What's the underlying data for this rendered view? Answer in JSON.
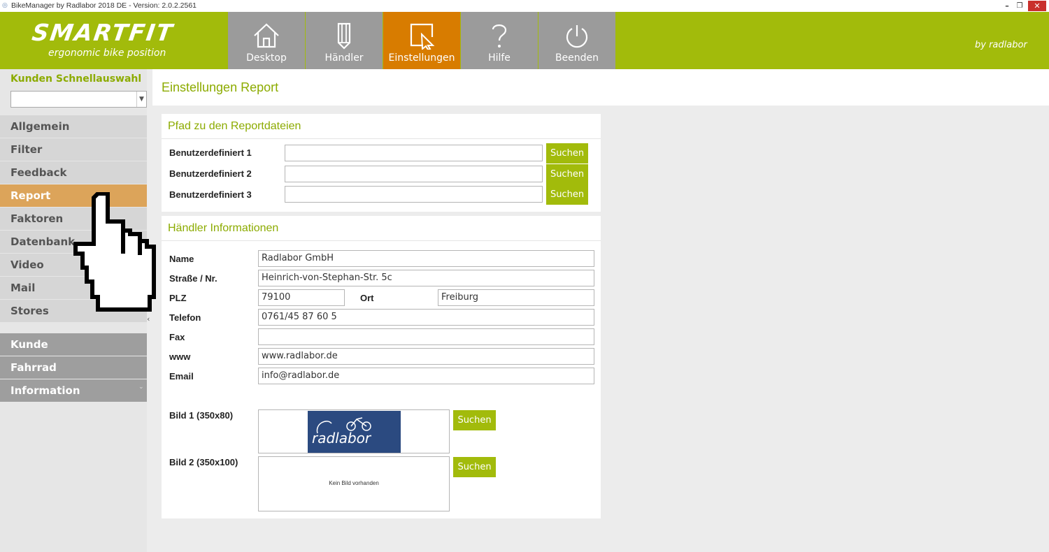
{
  "window": {
    "title": "BikeManager by Radlabor 2018 DE - Version: 2.0.2.2561",
    "minimize": "–",
    "maximize": "❐",
    "close": "✕"
  },
  "header": {
    "brand": "SMARTFIT",
    "tagline": "ergonomic bike position",
    "by_label": "by radlabor",
    "nav": [
      {
        "label": "Desktop",
        "icon": "home-icon",
        "active": false
      },
      {
        "label": "Händler",
        "icon": "pencil-icon",
        "active": false
      },
      {
        "label": "Einstellungen",
        "icon": "cursor-icon",
        "active": true
      },
      {
        "label": "Hilfe",
        "icon": "question-icon",
        "active": false
      },
      {
        "label": "Beenden",
        "icon": "power-icon",
        "active": false
      }
    ]
  },
  "sidebar": {
    "quick_select_title": "Kunden Schnellauswahl",
    "quick_select_value": "",
    "items": [
      "Allgemein",
      "Filter",
      "Feedback",
      "Report",
      "Faktoren",
      "Datenbank",
      "Video",
      "Mail",
      "Stores"
    ],
    "active_item": "Report",
    "sections": [
      "Kunde",
      "Fahrrad",
      "Information"
    ],
    "collapse_arrow": "‹"
  },
  "page": {
    "title": "Einstellungen Report"
  },
  "report_paths": {
    "title": "Pfad zu den Reportdateien",
    "rows": [
      {
        "label": "Benutzerdefiniert 1",
        "value": "",
        "button": "Suchen"
      },
      {
        "label": "Benutzerdefiniert 2",
        "value": "",
        "button": "Suchen"
      },
      {
        "label": "Benutzerdefiniert 3",
        "value": "",
        "button": "Suchen"
      }
    ]
  },
  "dealer": {
    "title": "Händler Informationen",
    "name_label": "Name",
    "name_value": "Radlabor GmbH",
    "street_label": "Straße / Nr.",
    "street_value": "Heinrich-von-Stephan-Str. 5c",
    "plz_label": "PLZ",
    "plz_value": "79100",
    "ort_label": "Ort",
    "ort_value": "Freiburg",
    "telefon_label": "Telefon",
    "telefon_value": "0761/45 87 60 5",
    "fax_label": "Fax",
    "fax_value": "",
    "www_label": "www",
    "www_value": "www.radlabor.de",
    "email_label": "Email",
    "email_value": "info@radlabor.de",
    "bild1_label": "Bild 1 (350x80)",
    "bild1_logo_text": "radlabor",
    "bild1_button": "Suchen",
    "bild2_label": "Bild 2 (350x100)",
    "bild2_placeholder": "Kein Bild vorhanden",
    "bild2_button": "Suchen"
  },
  "colors": {
    "brand_green": "#a2bb0b",
    "active_orange": "#d87c00",
    "sidebar_active": "#dca45a",
    "nav_gray": "#9b9b9b"
  }
}
